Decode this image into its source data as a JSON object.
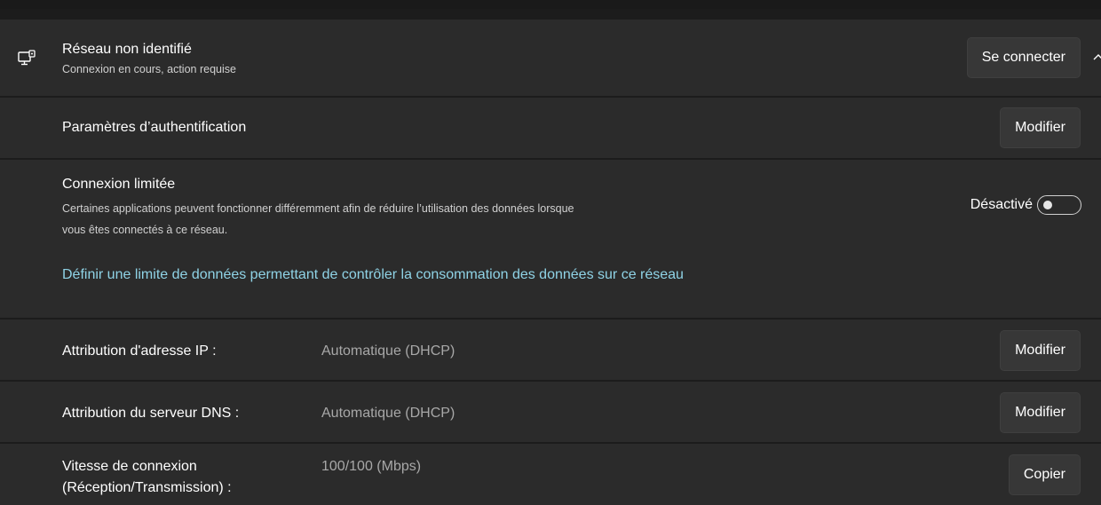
{
  "network": {
    "icon": "monitor-network-icon",
    "name": "Réseau non identifié",
    "status": "Connexion en cours, action requise",
    "connect_button": "Se connecter",
    "collapse_icon": "chevron-up-icon"
  },
  "authentication": {
    "title": "Paramètres d’authentification",
    "button": "Modifier"
  },
  "metered": {
    "title": "Connexion limitée",
    "description_line1": "Certaines applications peuvent fonctionner différemment afin de réduire l’utilisation des données lorsque",
    "description_line2": "vous êtes connectés à ce réseau.",
    "toggle_label": "Désactivé",
    "toggle_on": false,
    "data_limit_link": "Définir une limite de données permettant de contrôler la consommation des données sur ce réseau"
  },
  "ip_assignment": {
    "label": "Attribution d'adresse IP :",
    "value": "Automatique (DHCP)",
    "button": "Modifier"
  },
  "dns_assignment": {
    "label": "Attribution du serveur DNS :",
    "value": "Automatique (DHCP)",
    "button": "Modifier"
  },
  "link_speed": {
    "label_line1": "Vitesse de connexion",
    "label_line2": "(Réception/Transmission) :",
    "value": "100/100 (Mbps)",
    "button": "Copier"
  },
  "colors": {
    "background": "#1c1c1c",
    "card": "#2b2b2b",
    "button": "#373737",
    "link": "#8fd3e6",
    "secondary_text": "#a8a8a8"
  }
}
